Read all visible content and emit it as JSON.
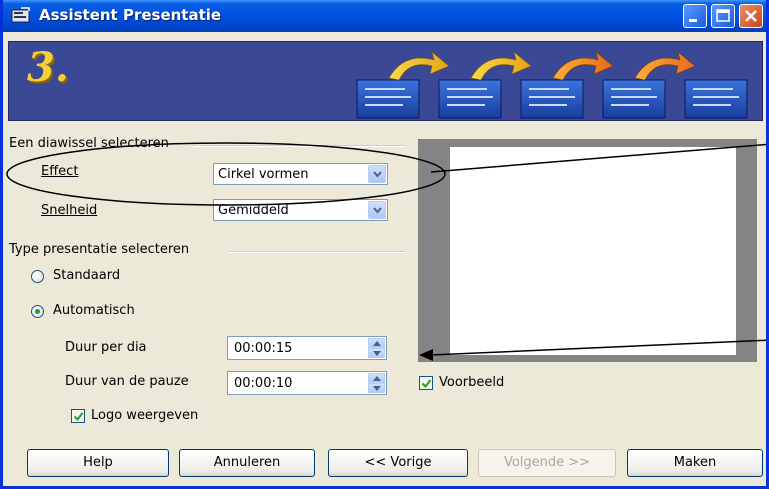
{
  "window": {
    "title": "Assistent Presentatie"
  },
  "banner": {
    "step_number": "3."
  },
  "transition_group": {
    "label": "Een diawissel selecteren",
    "effect_label": "Effect",
    "effect_value": "Cirkel vormen",
    "speed_label": "Snelheid",
    "speed_value": "Gemiddeld"
  },
  "presentation_group": {
    "label": "Type presentatie selecteren",
    "standard_label": "Standaard",
    "automatic_label": "Automatisch",
    "selected": "Automatisch",
    "duration_label": "Duur per dia",
    "duration_value": "00:00:15",
    "pause_label": "Duur van de pauze",
    "pause_value": "00:00:10",
    "logo_label": "Logo weergeven",
    "logo_checked": true
  },
  "preview": {
    "checkbox_label": "Voorbeeld",
    "checked": true
  },
  "buttons": {
    "help": "Help",
    "cancel": "Annuleren",
    "back": "<< Vorige",
    "next": "Volgende >>",
    "create": "Maken"
  }
}
